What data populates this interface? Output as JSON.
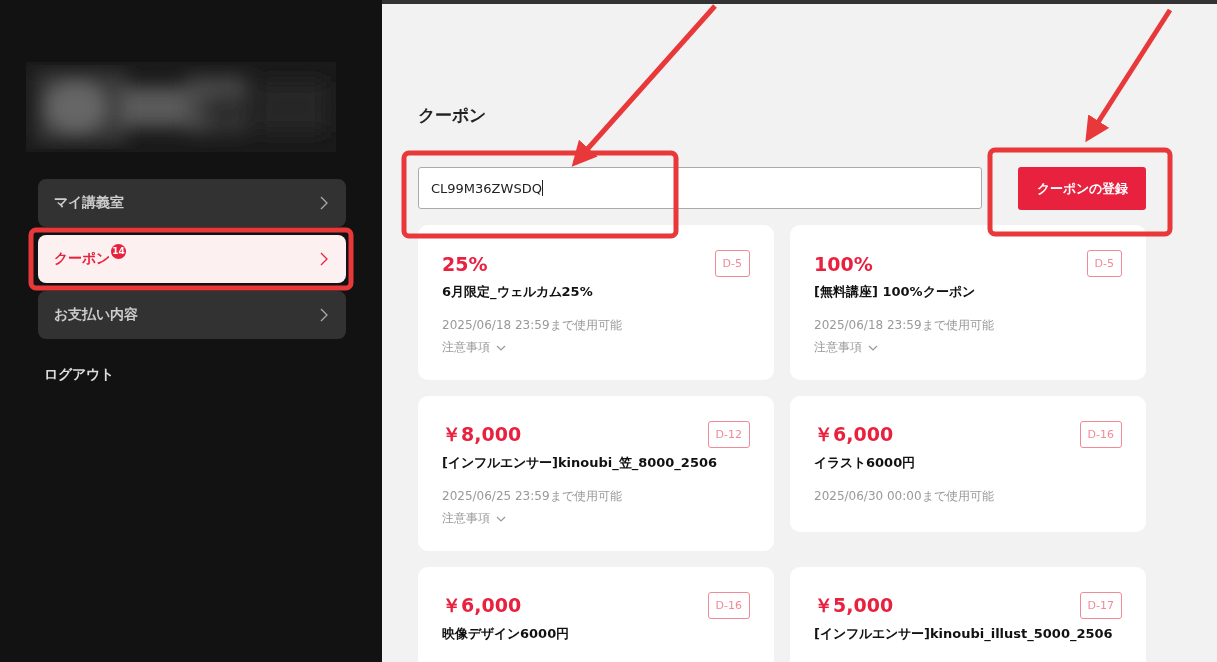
{
  "sidebar": {
    "items": [
      {
        "label": "マイ講義室",
        "selected": false
      },
      {
        "label": "クーポン",
        "selected": true,
        "badge": "14"
      },
      {
        "label": "お支払い内容",
        "selected": false
      }
    ],
    "logout": "ログアウト"
  },
  "page_title": "クーポン",
  "coupon_input": {
    "value": "CL99M36ZWSDQ"
  },
  "register_button": "クーポンの登録",
  "coupons": [
    {
      "amount": "25%",
      "days_left": "D-5",
      "title": "6月限定_ウェルカム25%",
      "expiry": "2025/06/18 23:59まで使用可能",
      "notes": "注意事項"
    },
    {
      "amount": "100%",
      "days_left": "D-5",
      "title": "[無料講座] 100%クーポン",
      "expiry": "2025/06/18 23:59まで使用可能",
      "notes": "注意事項"
    },
    {
      "amount": "￥8,000",
      "days_left": "D-12",
      "title": "[インフルエンサー]kinoubi_笠_8000_2506",
      "expiry": "2025/06/25 23:59まで使用可能",
      "notes": "注意事項"
    },
    {
      "amount": "￥6,000",
      "days_left": "D-16",
      "title": "イラスト6000円",
      "expiry": "2025/06/30 00:00まで使用可能"
    },
    {
      "amount": "￥6,000",
      "days_left": "D-16",
      "title": "映像デザイン6000円"
    },
    {
      "amount": "￥5,000",
      "days_left": "D-17",
      "title": "[インフルエンサー]kinoubi_illust_5000_2506"
    }
  ]
}
